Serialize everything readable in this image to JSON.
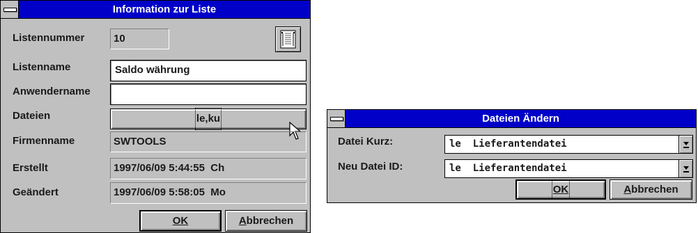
{
  "info_dialog": {
    "title": "Information zur Liste",
    "fields": {
      "list_number": {
        "label": "Listennummer",
        "value": "10"
      },
      "list_name": {
        "label": "Listenname",
        "value": "Saldo währung"
      },
      "user_name": {
        "label": "Anwendername",
        "value": ""
      },
      "files": {
        "label": "Dateien",
        "value": "le,ku"
      },
      "company_name": {
        "label": "Firmenname",
        "value": "SWTOOLS"
      },
      "created": {
        "label": "Erstellt",
        "value": "1997/06/09 5:44:55  Ch"
      },
      "modified": {
        "label": "Geändert",
        "value": "1997/06/09 5:58:05  Mo"
      }
    },
    "icon": "list-document-icon",
    "buttons": {
      "ok": "OK",
      "cancel_rest": "bbrechen",
      "cancel_mnemonic": "A"
    }
  },
  "change_files_dialog": {
    "title": "Dateien Ändern",
    "fields": {
      "file_short": {
        "label": "Datei Kurz:",
        "value": "le  Lieferantendatei"
      },
      "new_file_id": {
        "label": "Neu Datei ID:",
        "value": "le  Lieferantendatei"
      }
    },
    "buttons": {
      "ok": "OK",
      "cancel_rest": "bbrechen",
      "cancel_mnemonic": "A"
    }
  },
  "colors": {
    "titlebar": "#0000c8",
    "face": "#c0c0c0",
    "title_text": "#ffffff"
  }
}
